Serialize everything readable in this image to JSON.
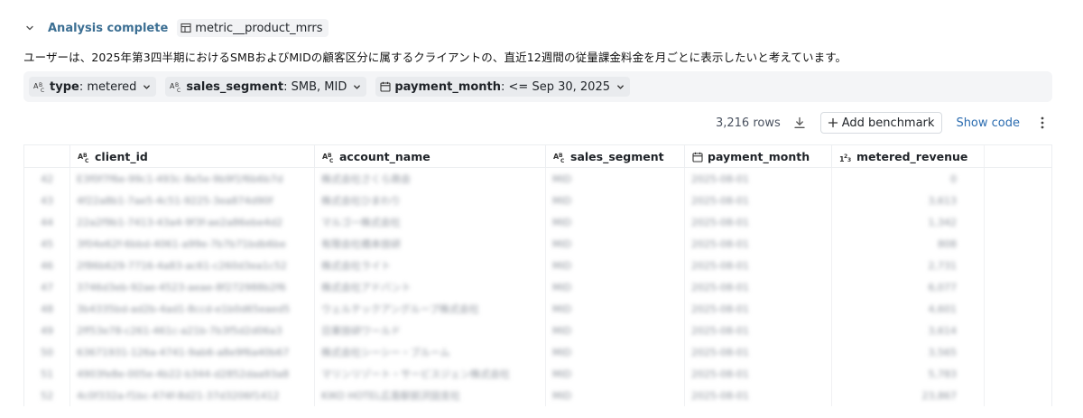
{
  "status": {
    "label": "Analysis complete",
    "metric_name": "metric__product_mrrs"
  },
  "question": "ユーザーは、2025年第3四半期におけるSMBおよびMIDの顧客区分に属するクライアントの、直近12週間の従量課金料金を月ごとに表示したいと考えています。",
  "filters": [
    {
      "key": "type",
      "value": ": metered"
    },
    {
      "key": "sales_segment",
      "value": ": SMB, MID"
    },
    {
      "key": "payment_month",
      "value": ": <= Sep 30, 2025"
    }
  ],
  "toolbar": {
    "row_count": "3,216 rows",
    "benchmark_label": "Add benchmark",
    "show_code_label": "Show code"
  },
  "columns": [
    "client_id",
    "account_name",
    "sales_segment",
    "payment_month",
    "metered_revenue"
  ],
  "rows": [
    {
      "idx": "42",
      "client_id": "E3f0f7f6e-99c1-493c-8e5e-9b9f1f6b6b7d",
      "account_name": "株式会社さくら商会",
      "segment": "MID",
      "month": "2025-08-01",
      "revenue": "0"
    },
    {
      "idx": "43",
      "client_id": "4f22a8b1-7ae5-4c51-9225-3ea874d90f",
      "account_name": "株式会社ひまわり",
      "segment": "MID",
      "month": "2025-08-01",
      "revenue": "3,613"
    },
    {
      "idx": "44",
      "client_id": "22a2f9b1-7413-43a4-9f3f-ae2a86ebe4d2",
      "account_name": "マルゴ一株式会社",
      "segment": "MID",
      "month": "2025-08-01",
      "revenue": "1,342"
    },
    {
      "idx": "45",
      "client_id": "3f04e62f-6bbd-4061-a99e-7b7b71bdb6be",
      "account_name": "有限会社橋本技研",
      "segment": "MID",
      "month": "2025-08-01",
      "revenue": "808"
    },
    {
      "idx": "46",
      "client_id": "2f86b629-7716-4a83-ac61-c260d3ea1c52",
      "account_name": "株式会社ライト",
      "segment": "MID",
      "month": "2025-08-01",
      "revenue": "2,731"
    },
    {
      "idx": "47",
      "client_id": "3746d3eb-92ae-4523-aeae-8f272988b2f6",
      "account_name": "株式会社アドバント",
      "segment": "MID",
      "month": "2025-08-01",
      "revenue": "6,077"
    },
    {
      "idx": "48",
      "client_id": "3b4335bd-ad2b-4ad1-8ccd-e1b0d65eaed5",
      "account_name": "ウェルテックアングループ株式会社",
      "segment": "MID",
      "month": "2025-08-01",
      "revenue": "4,601"
    },
    {
      "idx": "49",
      "client_id": "2ff53e78-c261-461c-a21b-7b3f5d2d06a3",
      "account_name": "日東技研ワールド",
      "segment": "MID",
      "month": "2025-08-01",
      "revenue": "3,614"
    },
    {
      "idx": "50",
      "client_id": "63671931-126a-4741-9ab6-a8e9f6a40b67",
      "account_name": "株式会社シーシー・ブルーム",
      "segment": "MID",
      "month": "2025-08-01",
      "revenue": "3,565"
    },
    {
      "idx": "51",
      "client_id": "4903fe8e-005e-4b22-b344-d2852daa93a8",
      "account_name": "マリンリゾート・サービスジェン株式会社",
      "segment": "MID",
      "month": "2025-08-01",
      "revenue": "5,783"
    },
    {
      "idx": "52",
      "client_id": "4c0f332a-f1bc-474f-8d21-37d3206f1412",
      "account_name": "KIKO HOTEL広島駅前沢田支社",
      "segment": "MID",
      "month": "2025-08-01",
      "revenue": "23,867"
    }
  ]
}
